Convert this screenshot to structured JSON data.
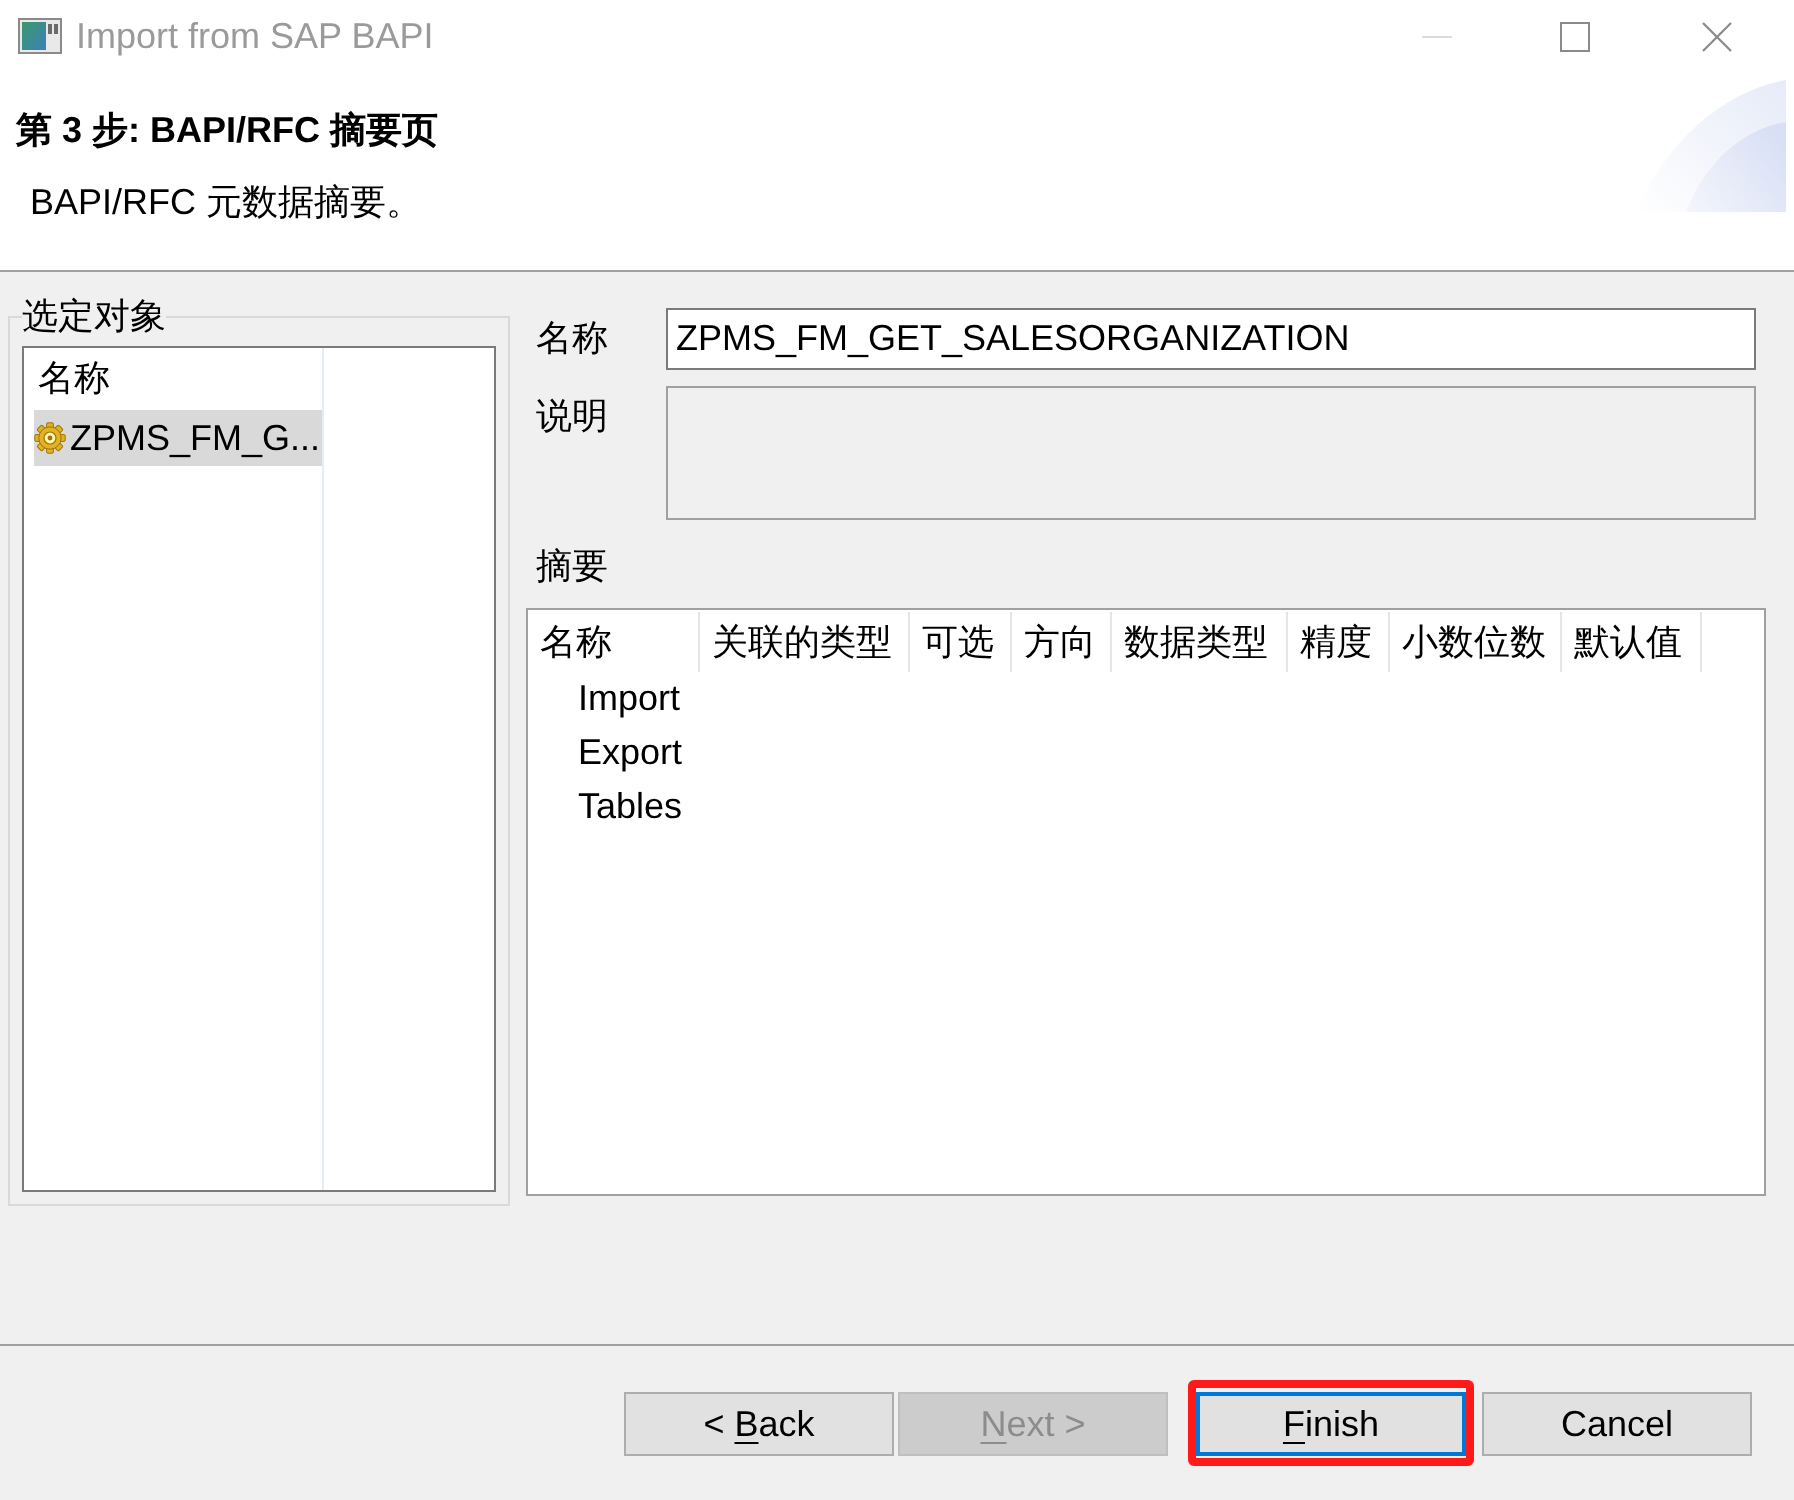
{
  "window": {
    "title": "Import from SAP BAPI"
  },
  "header": {
    "title": "第 3 步: BAPI/RFC 摘要页",
    "description": "BAPI/RFC 元数据摘要。"
  },
  "selected_objects": {
    "label": "选定对象",
    "columns": [
      "名称"
    ],
    "items": [
      {
        "name": "ZPMS_FM_G...",
        "selected": true
      }
    ]
  },
  "details": {
    "fields": [
      {
        "label": "名称",
        "kind": "text",
        "value": "ZPMS_FM_GET_SALESORGANIZATION"
      },
      {
        "label": "说明",
        "kind": "textarea"
      }
    ]
  },
  "summary": {
    "label": "摘要",
    "columns": [
      "名称",
      "关联的类型",
      "可选",
      "方向",
      "数据类型",
      "精度",
      "小数位数",
      "默认值"
    ],
    "rows": [
      {
        "name": "Import"
      },
      {
        "name": "Export"
      },
      {
        "name": "Tables"
      }
    ]
  },
  "buttons": [
    {
      "label_parts": [
        {
          "text": "< ",
          "underlined": false
        },
        {
          "text": "B",
          "underlined": true
        },
        {
          "text": "ack",
          "underlined": false
        }
      ],
      "disabled": false,
      "focused": false,
      "highlighted": false
    },
    {
      "label_parts": [
        {
          "text": "N",
          "underlined": true
        },
        {
          "text": "ext >",
          "underlined": false
        }
      ],
      "disabled": true,
      "focused": false,
      "highlighted": false
    },
    {
      "label_parts": [
        {
          "text": "F",
          "underlined": true
        },
        {
          "text": "inish",
          "underlined": false
        }
      ],
      "disabled": false,
      "focused": true,
      "highlighted": true
    },
    {
      "label_parts": [
        {
          "text": "Cancel",
          "underlined": false
        }
      ],
      "disabled": false,
      "focused": false,
      "highlighted": false
    }
  ]
}
